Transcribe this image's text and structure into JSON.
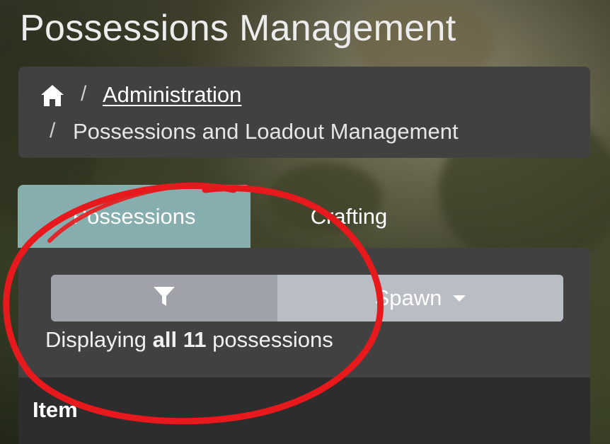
{
  "page": {
    "title": "Possessions Management"
  },
  "breadcrumb": {
    "home_icon": "home-icon",
    "separator": "/",
    "items": [
      {
        "label": "Administration",
        "link": true
      },
      {
        "label": "Possessions and Loadout Management",
        "link": false
      }
    ]
  },
  "tabs": [
    {
      "label": "Possessions",
      "active": true
    },
    {
      "label": "Crafting",
      "active": false
    }
  ],
  "toolbar": {
    "filter_icon": "filter-icon",
    "spawn_label": "Spawn",
    "spawn_icon": "caret-down-icon"
  },
  "status": {
    "prefix": "Displaying ",
    "emphasis": "all 11",
    "suffix": " possessions"
  },
  "table": {
    "columns": [
      "Item"
    ]
  },
  "colors": {
    "active_tab": "#86aeae",
    "panel": "#414141",
    "annotation": "#e8191d"
  }
}
